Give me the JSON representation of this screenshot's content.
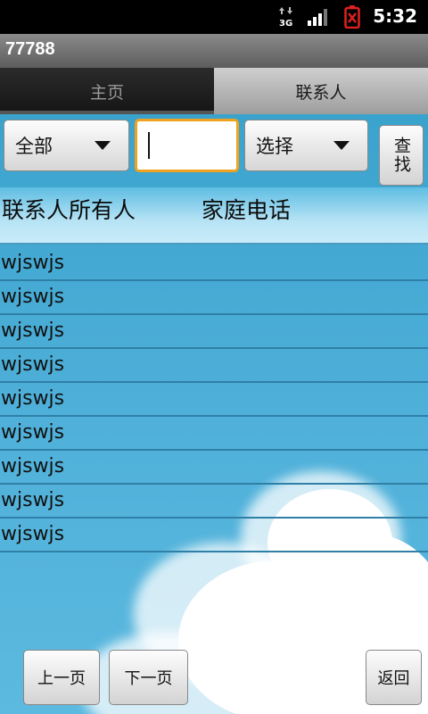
{
  "status": {
    "time": "5:32",
    "network": "3G"
  },
  "app": {
    "title": "77788"
  },
  "tabs": [
    {
      "label": "主页",
      "selected": false
    },
    {
      "label": "联系人",
      "selected": true
    }
  ],
  "toolbar": {
    "filter_value": "全部",
    "search_value": "",
    "select_value": "选择",
    "search_label": "查找"
  },
  "table": {
    "headers": [
      "联系人所有人",
      "家庭电话"
    ],
    "rows": [
      "wjswjs",
      "wjswjs",
      "wjswjs",
      "wjswjs",
      "wjswjs",
      "wjswjs",
      "wjswjs",
      "wjswjs",
      "wjswjs"
    ]
  },
  "footer": {
    "prev_label": "上一页",
    "next_label": "下一页",
    "back_label": "返回"
  },
  "colors": {
    "focus_border": "#f0a21e",
    "battery_alert": "#e02020",
    "background_blue": "#4fb0d9"
  }
}
